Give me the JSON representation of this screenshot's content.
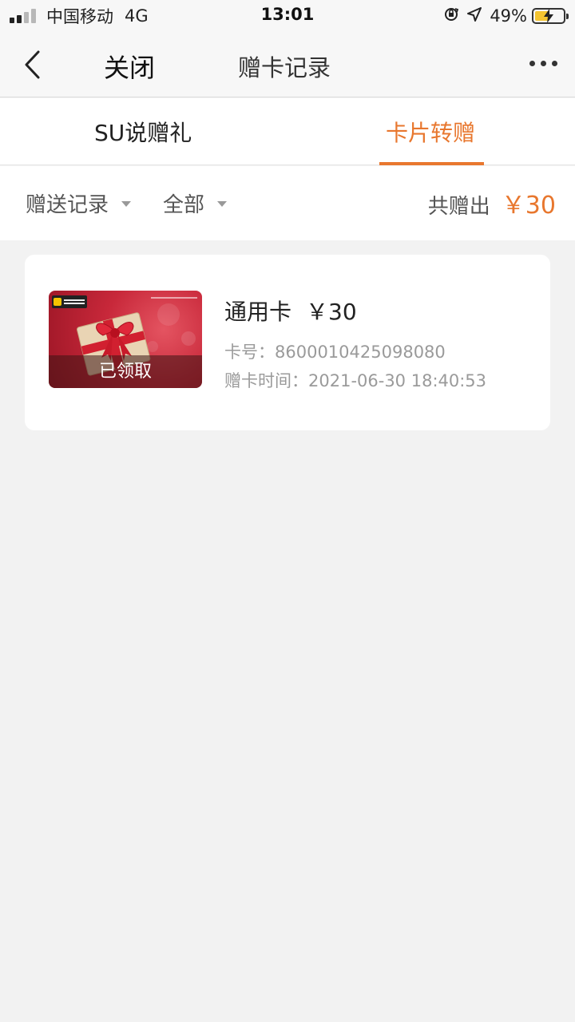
{
  "status_bar": {
    "carrier": "中国移动",
    "network": "4G",
    "time": "13:01",
    "battery_percent": "49%",
    "battery_level": 0.49,
    "icons": [
      "signal-icon",
      "orientation-lock-icon",
      "location-icon",
      "battery-charging-icon"
    ]
  },
  "nav": {
    "close_label": "关闭",
    "title": "赠卡记录",
    "icons": [
      "back-chevron-icon",
      "more-dots-icon"
    ]
  },
  "tabs": [
    {
      "label": "SU说赠礼",
      "active": false
    },
    {
      "label": "卡片转赠",
      "active": true
    }
  ],
  "filters": {
    "record_type": "赠送记录",
    "status": "全部",
    "total_label": "共赠出",
    "total_amount": "￥30"
  },
  "records": [
    {
      "name": "通用卡",
      "amount": "￥30",
      "card_no": "卡号：8600010425098080",
      "gift_time": "赠卡时间：2021-06-30 18:40:53",
      "status": "已领取"
    }
  ],
  "colors": {
    "accent": "#e8772e",
    "background": "#f2f2f2",
    "card": "#ffffff",
    "gift_red": "#c8283a"
  }
}
